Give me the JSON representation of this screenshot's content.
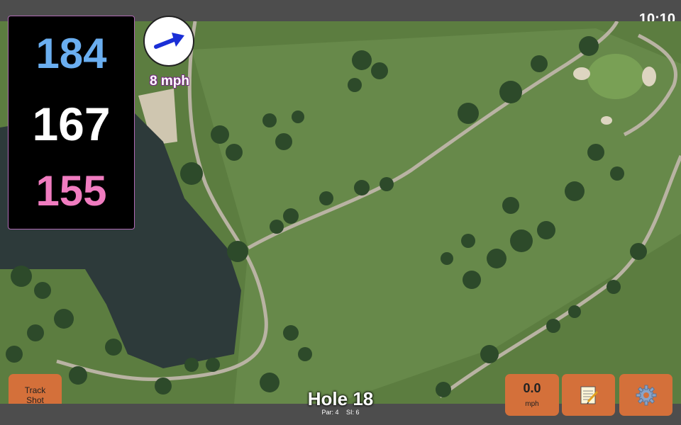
{
  "status": {
    "time": "10:10"
  },
  "distances": {
    "back": "184",
    "middle": "167",
    "front": "155"
  },
  "wind": {
    "speed_label": "8 mph",
    "icon": "arrow-right-icon"
  },
  "hole": {
    "title": "Hole 18",
    "par": "Par: 4",
    "si": "SI: 6"
  },
  "buttons": {
    "track_line1": "Track",
    "track_line2": "Shot",
    "speed_value": "0.0",
    "speed_unit": "mph",
    "notes_icon": "notepad-icon",
    "settings_icon": "gear-icon"
  },
  "colors": {
    "back": "#6aaef0",
    "middle": "#ffffff",
    "front": "#f07cc0",
    "button": "#d4703a",
    "panel_border": "#b06ab5"
  }
}
